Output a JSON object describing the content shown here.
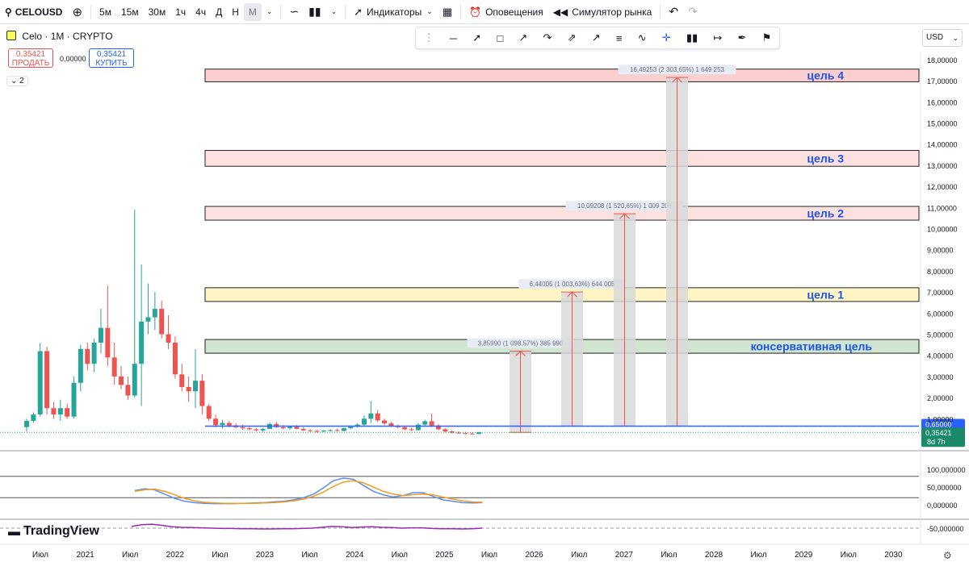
{
  "toolbar": {
    "search_icon": "search-icon",
    "symbol": "CELOUSD",
    "add_icon": "plus-circle-icon",
    "intervals": [
      "5м",
      "15м",
      "30м",
      "1ч",
      "4ч",
      "Д",
      "Н",
      "М"
    ],
    "active_interval": "М",
    "indicators_label": "Индикаторы",
    "alerts_label": "Оповещения",
    "replay_label": "Симулятор рынка",
    "undo_icon": "undo-icon",
    "redo_icon": "redo-icon"
  },
  "legend": {
    "title": "Celo · 1М · CRYPTO",
    "sell_price": "0,35421",
    "sell_label": "ПРОДАТЬ",
    "spread": "0,00000",
    "buy_price": "0,35421",
    "buy_label": "КУПИТЬ",
    "collapse": "2"
  },
  "currency": "USD",
  "brand": "TradingView",
  "colors": {
    "up": "#26a69a",
    "down": "#ef5350",
    "blue_line": "#2962ff",
    "label_blue": "#1e53e5",
    "last_price": "#1b8a6b"
  },
  "chart_data": [
    {
      "type": "candlestick",
      "title": "Celo · 1М · CRYPTO",
      "x_axis": [
        "Июл",
        "2021",
        "Июл",
        "2022",
        "Июл",
        "2023",
        "Июл",
        "2024",
        "Июл",
        "2025",
        "Июл",
        "2026",
        "Июл",
        "2027",
        "Июл",
        "2028",
        "Июл",
        "2029",
        "Июл",
        "2030"
      ],
      "y_axis_ticks": [
        "18,00000",
        "17,00000",
        "16,00000",
        "15,00000",
        "14,00000",
        "13,00000",
        "12,00000",
        "11,00000",
        "10,00000",
        "9,00000",
        "8,00000",
        "7,00000",
        "6,00000",
        "5,00000",
        "4,00000",
        "3,00000",
        "2,00000",
        "1,00000"
      ],
      "ylim": [
        0,
        18
      ],
      "candles": [
        {
          "o": 0.6,
          "h": 1.0,
          "l": 0.4,
          "c": 0.9
        },
        {
          "o": 0.9,
          "h": 1.3,
          "l": 0.8,
          "c": 1.2
        },
        {
          "o": 1.2,
          "h": 4.6,
          "l": 1.1,
          "c": 4.2
        },
        {
          "o": 4.2,
          "h": 4.4,
          "l": 1.2,
          "c": 1.5
        },
        {
          "o": 1.5,
          "h": 1.8,
          "l": 1.0,
          "c": 1.2
        },
        {
          "o": 1.2,
          "h": 1.9,
          "l": 0.9,
          "c": 1.5
        },
        {
          "o": 1.5,
          "h": 1.7,
          "l": 1.0,
          "c": 1.1
        },
        {
          "o": 1.1,
          "h": 3.0,
          "l": 1.0,
          "c": 2.7
        },
        {
          "o": 2.7,
          "h": 4.5,
          "l": 2.3,
          "c": 4.3
        },
        {
          "o": 4.3,
          "h": 4.6,
          "l": 3.3,
          "c": 3.6
        },
        {
          "o": 3.6,
          "h": 4.8,
          "l": 3.2,
          "c": 4.6
        },
        {
          "o": 4.6,
          "h": 6.2,
          "l": 4.1,
          "c": 5.3
        },
        {
          "o": 5.3,
          "h": 7.3,
          "l": 3.5,
          "c": 3.9
        },
        {
          "o": 3.9,
          "h": 4.6,
          "l": 2.6,
          "c": 3.0
        },
        {
          "o": 3.0,
          "h": 3.5,
          "l": 2.4,
          "c": 2.6
        },
        {
          "o": 2.6,
          "h": 3.0,
          "l": 1.9,
          "c": 2.1
        },
        {
          "o": 2.1,
          "h": 10.9,
          "l": 2.0,
          "c": 3.6
        },
        {
          "o": 3.6,
          "h": 8.3,
          "l": 1.6,
          "c": 5.6
        },
        {
          "o": 5.6,
          "h": 7.4,
          "l": 5.0,
          "c": 5.8
        },
        {
          "o": 5.8,
          "h": 7.0,
          "l": 5.2,
          "c": 6.2
        },
        {
          "o": 6.2,
          "h": 6.6,
          "l": 4.8,
          "c": 5.0
        },
        {
          "o": 5.0,
          "h": 5.9,
          "l": 4.3,
          "c": 4.6
        },
        {
          "o": 4.6,
          "h": 4.9,
          "l": 2.9,
          "c": 3.1
        },
        {
          "o": 3.1,
          "h": 3.6,
          "l": 2.3,
          "c": 2.5
        },
        {
          "o": 2.5,
          "h": 3.0,
          "l": 1.8,
          "c": 2.3
        },
        {
          "o": 2.3,
          "h": 4.3,
          "l": 1.5,
          "c": 2.8
        },
        {
          "o": 2.8,
          "h": 3.1,
          "l": 1.2,
          "c": 1.6
        },
        {
          "o": 1.6,
          "h": 1.7,
          "l": 0.9,
          "c": 1.0
        },
        {
          "o": 1.0,
          "h": 1.2,
          "l": 0.6,
          "c": 0.7
        },
        {
          "o": 0.7,
          "h": 0.95,
          "l": 0.55,
          "c": 0.8
        },
        {
          "o": 0.8,
          "h": 0.9,
          "l": 0.6,
          "c": 0.68
        },
        {
          "o": 0.68,
          "h": 0.78,
          "l": 0.55,
          "c": 0.6
        },
        {
          "o": 0.6,
          "h": 0.72,
          "l": 0.48,
          "c": 0.55
        },
        {
          "o": 0.55,
          "h": 0.62,
          "l": 0.44,
          "c": 0.5
        },
        {
          "o": 0.5,
          "h": 0.56,
          "l": 0.4,
          "c": 0.45
        },
        {
          "o": 0.45,
          "h": 0.55,
          "l": 0.38,
          "c": 0.52
        },
        {
          "o": 0.52,
          "h": 0.82,
          "l": 0.5,
          "c": 0.75
        },
        {
          "o": 0.75,
          "h": 0.85,
          "l": 0.55,
          "c": 0.6
        },
        {
          "o": 0.6,
          "h": 0.7,
          "l": 0.5,
          "c": 0.55
        },
        {
          "o": 0.55,
          "h": 0.65,
          "l": 0.48,
          "c": 0.62
        },
        {
          "o": 0.62,
          "h": 0.7,
          "l": 0.5,
          "c": 0.52
        },
        {
          "o": 0.52,
          "h": 0.6,
          "l": 0.42,
          "c": 0.45
        },
        {
          "o": 0.45,
          "h": 0.5,
          "l": 0.38,
          "c": 0.42
        },
        {
          "o": 0.42,
          "h": 0.48,
          "l": 0.35,
          "c": 0.4
        },
        {
          "o": 0.4,
          "h": 0.46,
          "l": 0.36,
          "c": 0.44
        },
        {
          "o": 0.44,
          "h": 0.5,
          "l": 0.4,
          "c": 0.46
        },
        {
          "o": 0.46,
          "h": 0.52,
          "l": 0.4,
          "c": 0.42
        },
        {
          "o": 0.42,
          "h": 0.58,
          "l": 0.4,
          "c": 0.55
        },
        {
          "o": 0.55,
          "h": 0.68,
          "l": 0.5,
          "c": 0.62
        },
        {
          "o": 0.62,
          "h": 0.78,
          "l": 0.58,
          "c": 0.72
        },
        {
          "o": 0.72,
          "h": 1.15,
          "l": 0.65,
          "c": 1.0
        },
        {
          "o": 1.0,
          "h": 1.85,
          "l": 0.8,
          "c": 1.25
        },
        {
          "o": 1.25,
          "h": 1.4,
          "l": 0.85,
          "c": 0.92
        },
        {
          "o": 0.92,
          "h": 1.0,
          "l": 0.7,
          "c": 0.78
        },
        {
          "o": 0.78,
          "h": 0.85,
          "l": 0.6,
          "c": 0.66
        },
        {
          "o": 0.66,
          "h": 0.72,
          "l": 0.55,
          "c": 0.6
        },
        {
          "o": 0.6,
          "h": 0.66,
          "l": 0.45,
          "c": 0.5
        },
        {
          "o": 0.5,
          "h": 0.58,
          "l": 0.42,
          "c": 0.46
        },
        {
          "o": 0.46,
          "h": 0.8,
          "l": 0.44,
          "c": 0.72
        },
        {
          "o": 0.72,
          "h": 0.95,
          "l": 0.62,
          "c": 0.88
        },
        {
          "o": 0.88,
          "h": 1.25,
          "l": 0.6,
          "c": 0.68
        },
        {
          "o": 0.68,
          "h": 0.75,
          "l": 0.45,
          "c": 0.5
        },
        {
          "o": 0.5,
          "h": 0.55,
          "l": 0.35,
          "c": 0.4
        },
        {
          "o": 0.4,
          "h": 0.45,
          "l": 0.3,
          "c": 0.34
        },
        {
          "o": 0.34,
          "h": 0.4,
          "l": 0.28,
          "c": 0.32
        },
        {
          "o": 0.32,
          "h": 0.38,
          "l": 0.26,
          "c": 0.3
        },
        {
          "o": 0.3,
          "h": 0.35,
          "l": 0.25,
          "c": 0.28
        },
        {
          "o": 0.28,
          "h": 0.38,
          "l": 0.26,
          "c": 0.35421
        }
      ],
      "hlines": [
        {
          "name": "level",
          "value": 0.65,
          "label": "0,65000"
        },
        {
          "name": "last",
          "value": 0.35421,
          "label": "0,35421",
          "sublabel": "8d 7h"
        }
      ],
      "zones": [
        {
          "label": "консервативная цель",
          "low": 4.1,
          "high": 4.75,
          "fill": "#cfe5cf"
        },
        {
          "label": "цель 1",
          "low": 6.55,
          "high": 7.2,
          "fill": "#fdf6c4"
        },
        {
          "label": "цель 2",
          "low": 10.4,
          "high": 11.05,
          "fill": "#fde1e1"
        },
        {
          "label": "цель 3",
          "low": 12.95,
          "high": 13.7,
          "fill": "#fde1e1"
        },
        {
          "label": "цель 4",
          "low": 16.95,
          "high": 17.55,
          "fill": "#fbcfcf"
        }
      ],
      "projections": [
        {
          "from": 0.35421,
          "to": 4.2,
          "text": "3,85990 (1 098,57%) 385 990"
        },
        {
          "from": 0.65,
          "to": 7.0,
          "text": "6,44005 (1 003,63%) 644 005"
        },
        {
          "from": 0.65,
          "to": 10.7,
          "text": "10,09208 (1 520,65%) 1 009 208"
        },
        {
          "from": 0.65,
          "to": 17.15,
          "text": "16,49253 (2 303,65%) 1 649 253"
        }
      ]
    },
    {
      "type": "line",
      "title": "oscillator",
      "y_axis_ticks": [
        "100,000000",
        "50,000000",
        "0,000000"
      ],
      "ylim": [
        -10,
        110
      ],
      "series": [
        {
          "color": "#5b8def",
          "values": [
            40,
            45,
            42,
            30,
            18,
            10,
            6,
            4,
            3,
            3,
            3,
            4,
            5,
            6,
            8,
            10,
            14,
            20,
            30,
            48,
            68,
            75,
            72,
            55,
            38,
            28,
            22,
            26,
            34,
            34,
            24,
            14,
            10,
            6,
            5,
            6
          ]
        },
        {
          "color": "#f29d1f",
          "values": [
            38,
            42,
            44,
            38,
            28,
            18,
            11,
            7,
            5,
            4,
            4,
            4,
            4,
            5,
            6,
            8,
            11,
            16,
            24,
            36,
            52,
            64,
            68,
            62,
            50,
            38,
            30,
            26,
            28,
            30,
            28,
            22,
            16,
            11,
            8,
            7
          ]
        }
      ]
    },
    {
      "type": "line",
      "title": "second oscillator",
      "y_axis_ticks": [
        "-50,000000"
      ],
      "series": [
        {
          "color": "#9c27b0",
          "values": [
            -44,
            -38,
            -36,
            -40,
            -45,
            -47,
            -48,
            -49,
            -50,
            -51,
            -51,
            -52,
            -52,
            -53,
            -53,
            -52,
            -52,
            -51,
            -50,
            -47,
            -44,
            -45,
            -48,
            -46,
            -45,
            -47,
            -48,
            -50,
            -49,
            -49,
            -51,
            -52,
            -52,
            -53,
            -52,
            -50
          ]
        }
      ]
    }
  ]
}
